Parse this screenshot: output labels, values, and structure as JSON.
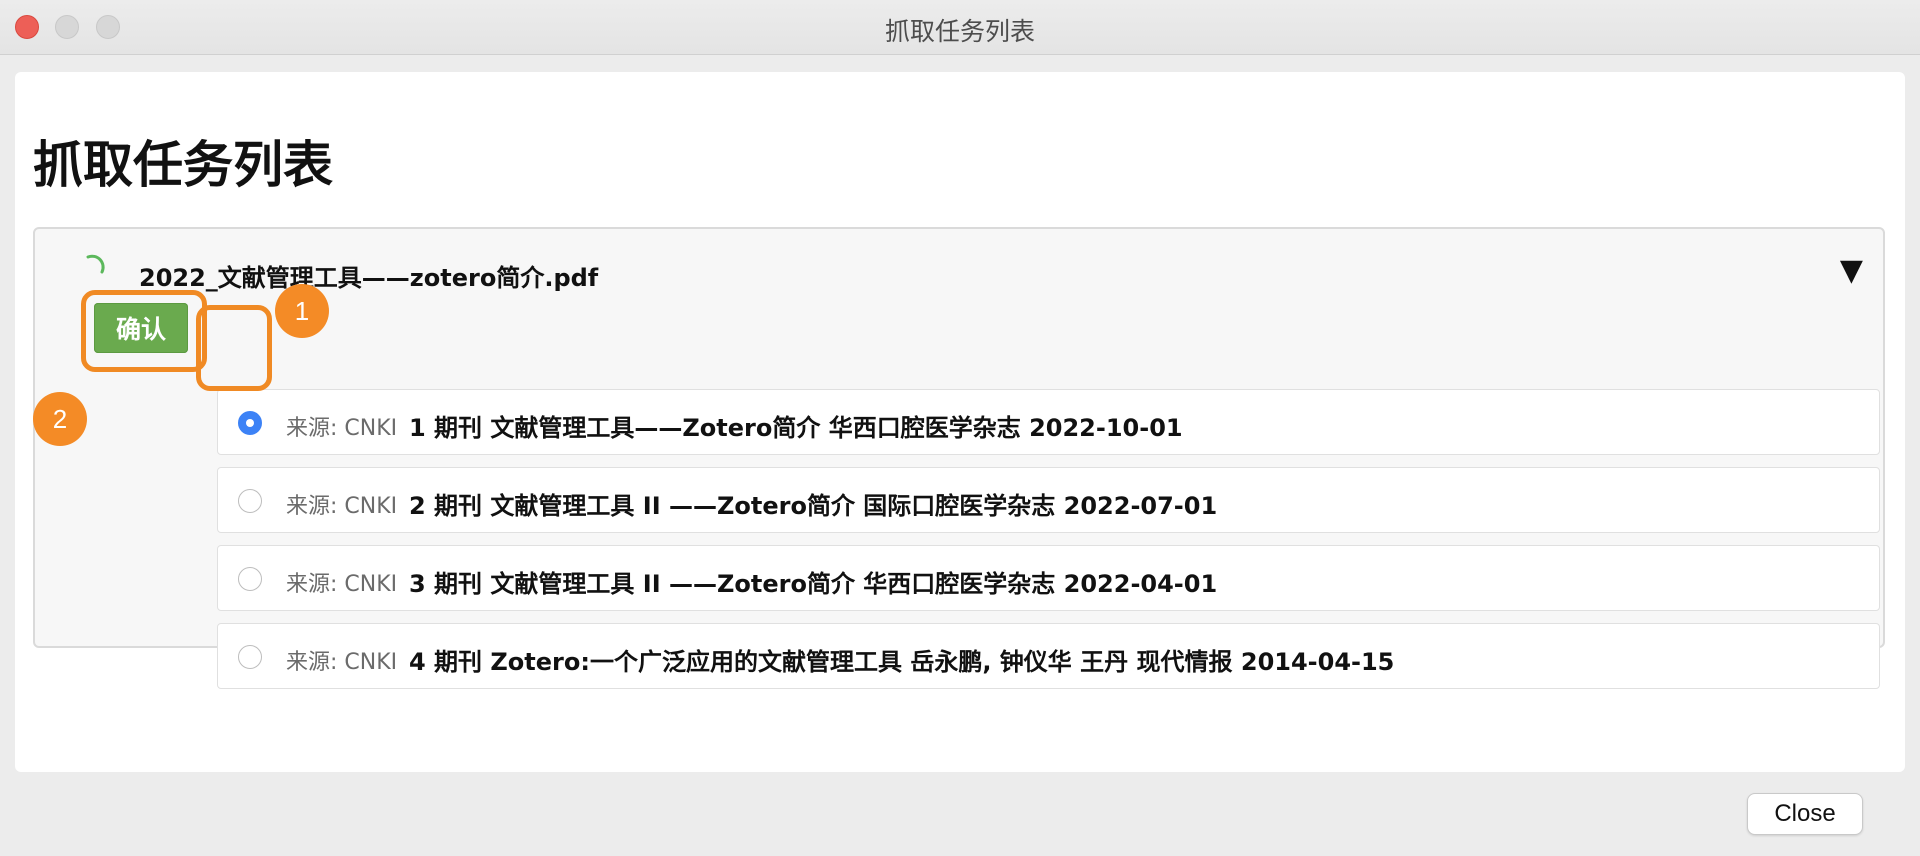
{
  "window": {
    "title": "抓取任务列表"
  },
  "page": {
    "heading": "抓取任务列表"
  },
  "task": {
    "file_name": "2022_文献管理工具——zotero简介.pdf",
    "collapse_icon": "▼",
    "confirm_label": "确认",
    "candidates": [
      {
        "source": "来源: CNKI",
        "text": "1 期刊 文献管理工具——Zotero简介 华西口腔医学杂志 2022-10-01",
        "selected": true
      },
      {
        "source": "来源: CNKI",
        "text": "2 期刊 文献管理工具 II ——Zotero简介 国际口腔医学杂志 2022-07-01",
        "selected": false
      },
      {
        "source": "来源: CNKI",
        "text": "3 期刊 文献管理工具 II ——Zotero简介 华西口腔医学杂志 2022-04-01",
        "selected": false
      },
      {
        "source": "来源: CNKI",
        "text": "4 期刊 Zotero:一个广泛应用的文献管理工具 岳永鹏, 钟仪华 王丹 现代情报 2014-04-15",
        "selected": false
      }
    ]
  },
  "annotations": {
    "badge_1": "1",
    "badge_2": "2"
  },
  "footer": {
    "close_label": "Close"
  },
  "colors": {
    "accent": "#f08a24",
    "confirm": "#6aaa4e",
    "radio_selected": "#3c82f6",
    "spinner": "#5cb85c"
  }
}
